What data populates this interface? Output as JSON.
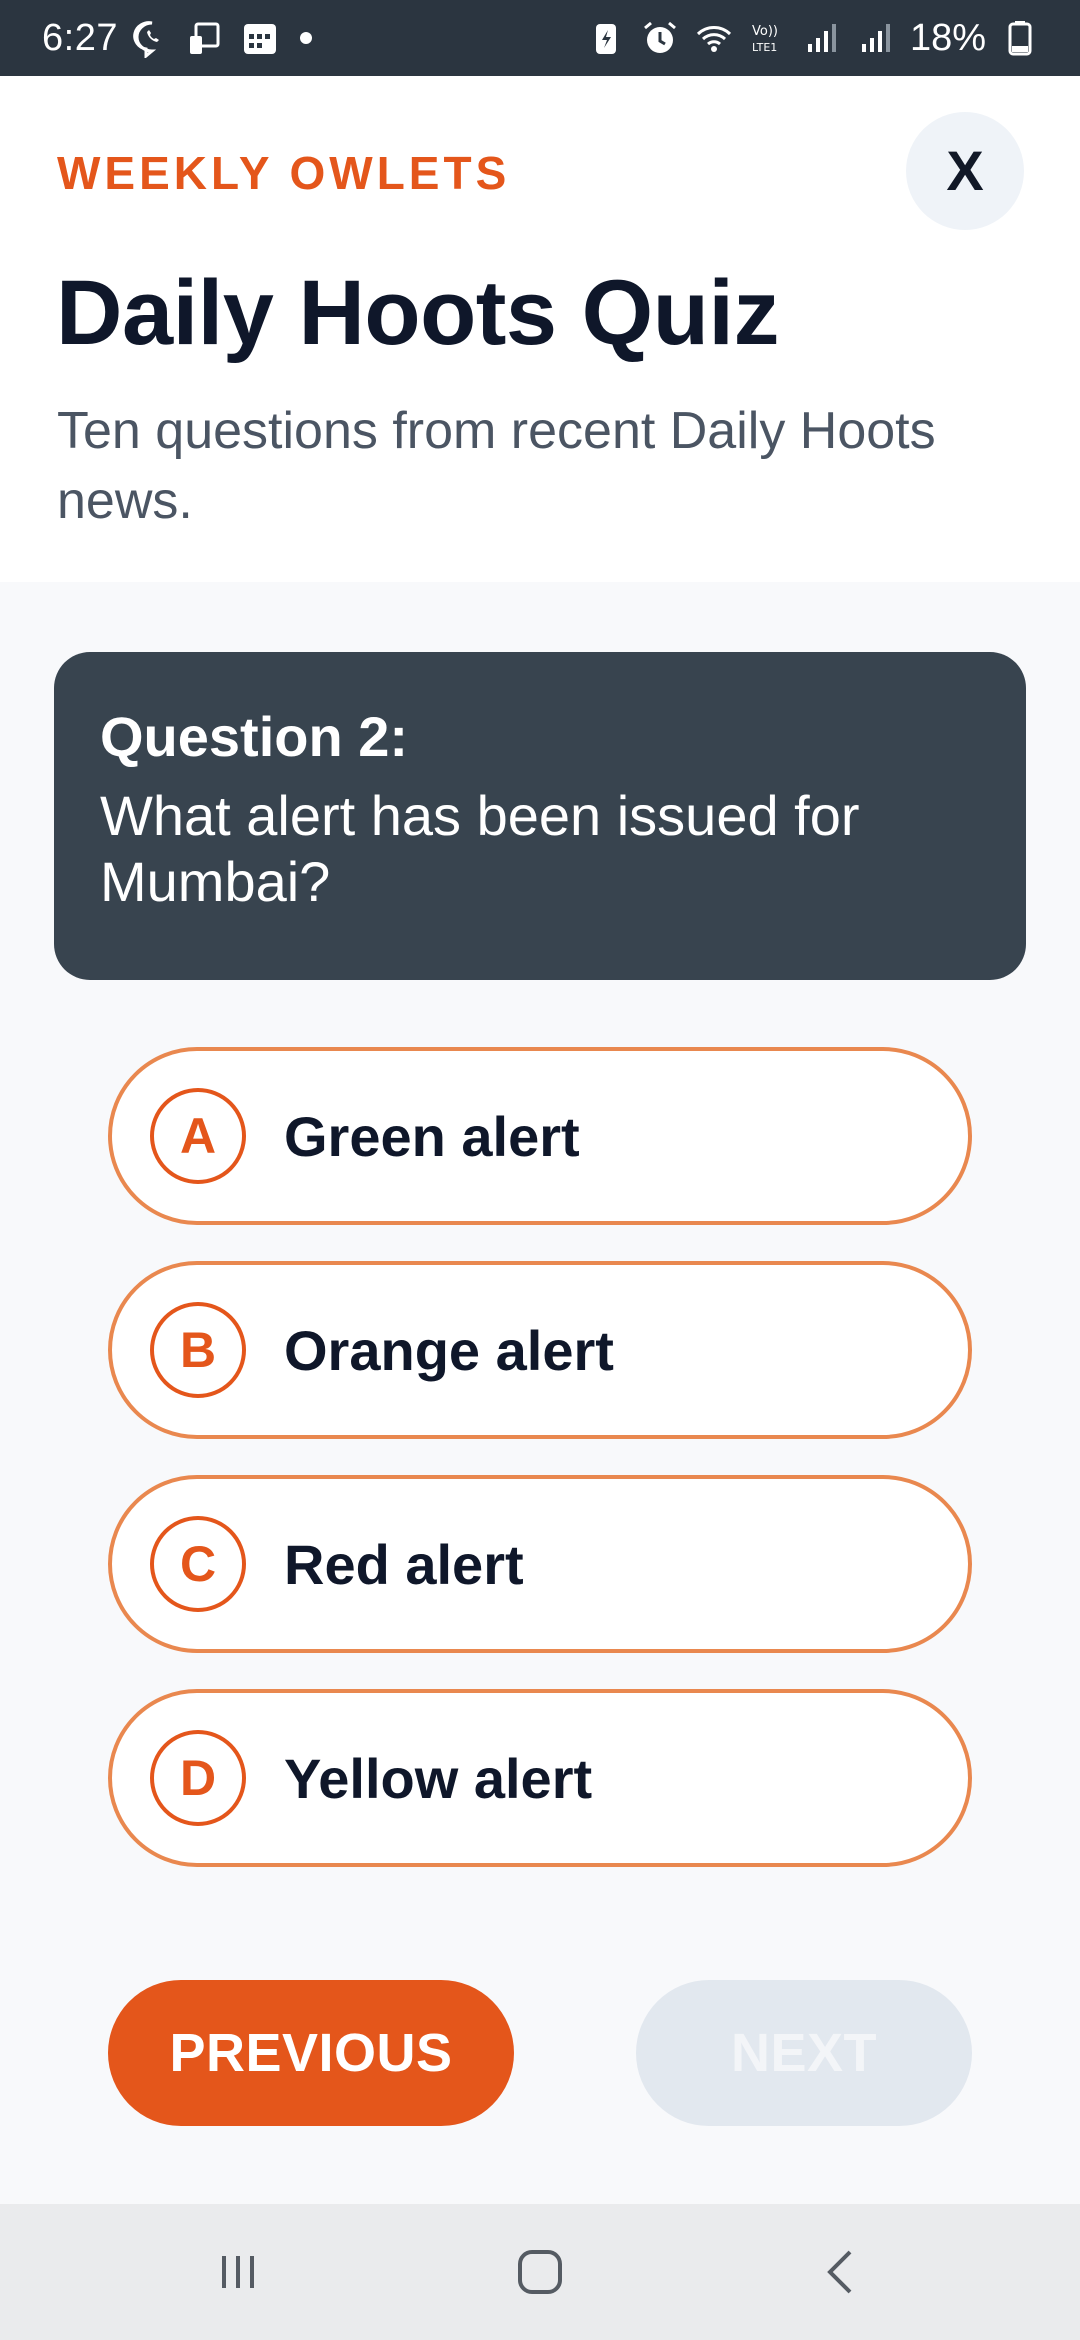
{
  "status_bar": {
    "time": "6:27",
    "battery_percent": "18%",
    "icons": [
      "viber-icon",
      "cast-icon",
      "calendar-icon",
      "battery-saver-icon",
      "alarm-icon",
      "wifi-icon",
      "volte-icon",
      "signal-icon",
      "signal-icon-2",
      "battery-icon"
    ]
  },
  "header": {
    "brand": "WEEKLY OWLETS",
    "close_label": "X",
    "title": "Daily Hoots Quiz",
    "subtitle": "Ten questions from recent Daily Hoots news."
  },
  "question": {
    "label": "Question 2:",
    "text": "What alert has been issued for Mumbai?"
  },
  "options": [
    {
      "letter": "A",
      "text": "Green alert"
    },
    {
      "letter": "B",
      "text": "Orange alert"
    },
    {
      "letter": "C",
      "text": "Red alert"
    },
    {
      "letter": "D",
      "text": "Yellow alert"
    }
  ],
  "navigation": {
    "previous_label": "PREVIOUS",
    "next_label": "NEXT"
  },
  "colors": {
    "accent": "#e4561b",
    "option_border": "#e9884f",
    "question_card": "#38444f",
    "status_bar": "#2b3540"
  },
  "system_nav": {
    "icons": [
      "recents-icon",
      "home-icon",
      "back-icon"
    ]
  }
}
